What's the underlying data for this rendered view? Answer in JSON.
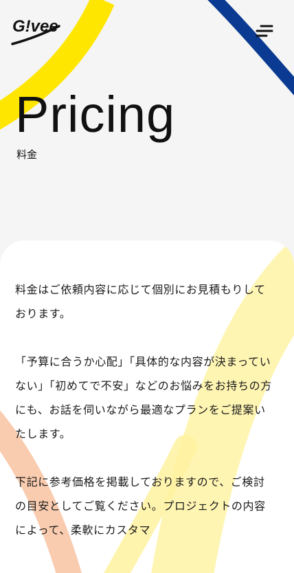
{
  "brand": {
    "logo_text": "G!vee",
    "colors": {
      "yellow": "#FFE600",
      "blue": "#0A3A91",
      "soft_yellow": "#FFF5B3",
      "peach": "#F8C6A6",
      "text": "#111111"
    }
  },
  "header": {
    "menu_icon": "hamburger-menu-icon"
  },
  "hero": {
    "title": "Pricing",
    "subtitle": "料金"
  },
  "content": {
    "paragraphs": [
      "料金はご依頼内容に応じて個別にお見積もりしております。",
      "「予算に合うか心配」「具体的な内容が決まっていない」「初めてで不安」などのお悩みをお持ちの方にも、お話を伺いながら最適なプランをご提案いたします。",
      "下記に参考価格を掲載しておりますので、ご検討の目安としてご覧ください。プロジェクトの内容によって、柔軟にカスタマ"
    ]
  }
}
